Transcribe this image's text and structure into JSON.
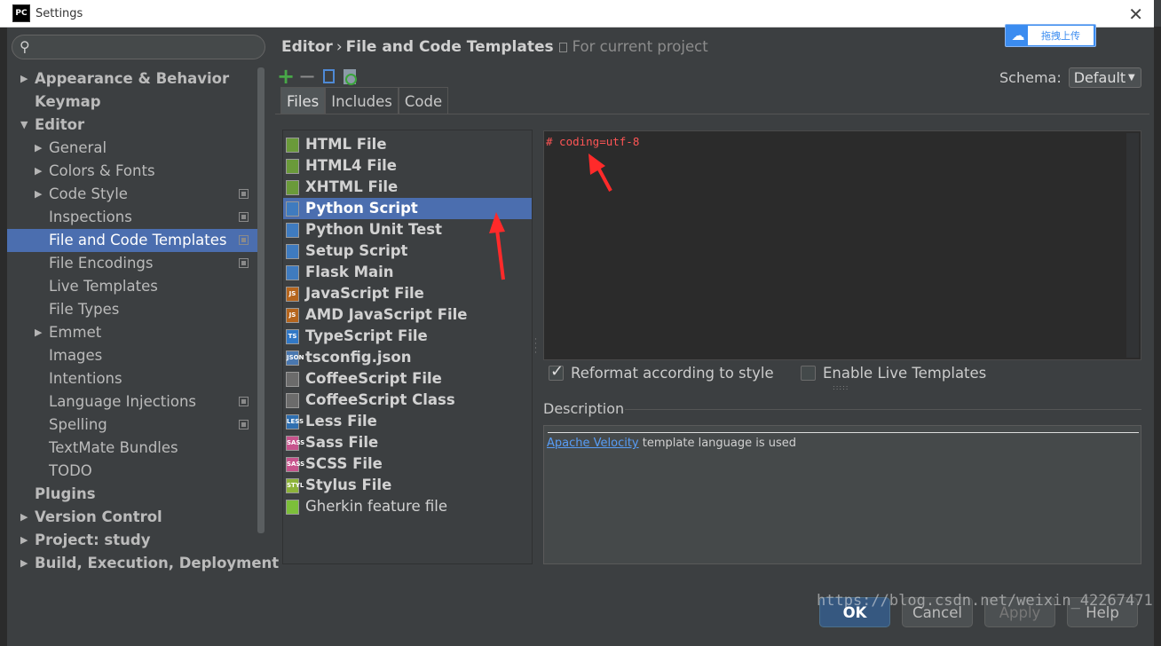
{
  "window": {
    "title": "Settings",
    "app_icon_text": "PC"
  },
  "search": {
    "placeholder": ""
  },
  "tree": [
    {
      "label": "Appearance & Behavior",
      "level": 0,
      "arrow": true,
      "bold": true
    },
    {
      "label": "Keymap",
      "level": 0,
      "arrow": false,
      "bold": true
    },
    {
      "label": "Editor",
      "level": 0,
      "arrow": "down",
      "bold": true
    },
    {
      "label": "General",
      "level": 1,
      "arrow": true
    },
    {
      "label": "Colors & Fonts",
      "level": 1,
      "arrow": true
    },
    {
      "label": "Code Style",
      "level": 1,
      "arrow": true,
      "copy": true
    },
    {
      "label": "Inspections",
      "level": 2,
      "copy": true
    },
    {
      "label": "File and Code Templates",
      "level": 2,
      "copy": true,
      "selected": true
    },
    {
      "label": "File Encodings",
      "level": 2,
      "copy": true
    },
    {
      "label": "Live Templates",
      "level": 2
    },
    {
      "label": "File Types",
      "level": 2
    },
    {
      "label": "Emmet",
      "level": 1,
      "arrow": true
    },
    {
      "label": "Images",
      "level": 2
    },
    {
      "label": "Intentions",
      "level": 2
    },
    {
      "label": "Language Injections",
      "level": 2,
      "copy": true
    },
    {
      "label": "Spelling",
      "level": 2,
      "copy": true
    },
    {
      "label": "TextMate Bundles",
      "level": 2
    },
    {
      "label": "TODO",
      "level": 2
    },
    {
      "label": "Plugins",
      "level": 0,
      "bold": true
    },
    {
      "label": "Version Control",
      "level": 0,
      "arrow": true,
      "bold": true
    },
    {
      "label": "Project: study",
      "level": 0,
      "arrow": true,
      "bold": true
    },
    {
      "label": "Build, Execution, Deployment",
      "level": 0,
      "arrow": true,
      "bold": true
    }
  ],
  "breadcrumb": {
    "part1": "Editor",
    "sep": "›",
    "part2": "File and Code Templates",
    "scope": "For current project"
  },
  "baidu": {
    "label": "拖拽上传"
  },
  "schema": {
    "label": "Schema:",
    "value": "Default"
  },
  "tabs": [
    "Files",
    "Includes",
    "Code"
  ],
  "templates": [
    {
      "label": "HTML File",
      "icon": "html-file-icon",
      "badge": "",
      "color": "#6a9a3a"
    },
    {
      "label": "HTML4 File",
      "icon": "html-file-icon",
      "badge": "",
      "color": "#6a9a3a"
    },
    {
      "label": "XHTML File",
      "icon": "xhtml-file-icon",
      "badge": "",
      "color": "#6a9a3a"
    },
    {
      "label": "Python Script",
      "icon": "python-file-icon",
      "badge": "",
      "color": "#3f7bbf",
      "selected": true
    },
    {
      "label": "Python Unit Test",
      "icon": "python-file-icon",
      "badge": "",
      "color": "#3f7bbf"
    },
    {
      "label": "Setup Script",
      "icon": "python-file-icon",
      "badge": "",
      "color": "#3f7bbf"
    },
    {
      "label": "Flask Main",
      "icon": "python-file-icon",
      "badge": "",
      "color": "#3f7bbf"
    },
    {
      "label": "JavaScript File",
      "icon": "javascript-file-icon",
      "badge": "JS",
      "color": "#b5651d"
    },
    {
      "label": "AMD JavaScript File",
      "icon": "javascript-file-icon",
      "badge": "JS",
      "color": "#b5651d"
    },
    {
      "label": "TypeScript File",
      "icon": "typescript-file-icon",
      "badge": "TS",
      "color": "#3178c6"
    },
    {
      "label": "tsconfig.json",
      "icon": "json-file-icon",
      "badge": "JSON",
      "color": "#4a78b0"
    },
    {
      "label": "CoffeeScript File",
      "icon": "coffeescript-file-icon",
      "badge": "",
      "color": "#6b6b6b"
    },
    {
      "label": "CoffeeScript Class",
      "icon": "coffeescript-file-icon",
      "badge": "",
      "color": "#6b6b6b"
    },
    {
      "label": "Less File",
      "icon": "less-file-icon",
      "badge": "LESS",
      "color": "#2f6fb0"
    },
    {
      "label": "Sass File",
      "icon": "sass-file-icon",
      "badge": "SASS",
      "color": "#c6538c"
    },
    {
      "label": "SCSS File",
      "icon": "scss-file-icon",
      "badge": "SASS",
      "color": "#c6538c"
    },
    {
      "label": "Stylus File",
      "icon": "stylus-file-icon",
      "badge": "STYL",
      "color": "#8db33a"
    },
    {
      "label": "Gherkin feature file",
      "icon": "gherkin-file-icon",
      "badge": "",
      "color": "#7cbf3a",
      "normal": true
    }
  ],
  "editor": {
    "code": "# coding=utf-8"
  },
  "options": {
    "reformat": {
      "label": "Reformat according to style",
      "checked": true
    },
    "live_templates": {
      "label": "Enable Live Templates",
      "checked": false
    }
  },
  "description": {
    "title": "Description",
    "link": "Apache Velocity",
    "text": " template language is used"
  },
  "buttons": {
    "ok": "OK",
    "cancel": "Cancel",
    "apply": "Apply",
    "help": "Help"
  },
  "watermark": "https://blog.csdn.net/weixin_42267471",
  "colors": {
    "accent": "#4b6eaf",
    "ok_button": "#365880",
    "annotation_arrow": "#ff2a2a"
  }
}
